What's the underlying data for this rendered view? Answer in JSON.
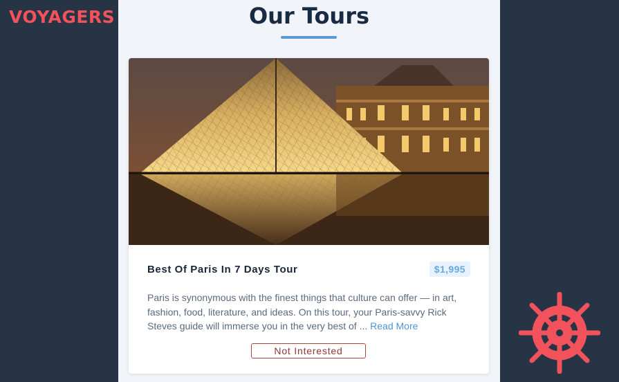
{
  "brand": {
    "name": "VOYAGERS",
    "color": "#f2525c"
  },
  "page": {
    "title": "Our Tours"
  },
  "tour": {
    "name": "Best Of Paris In 7 Days Tour",
    "price": "$1,995",
    "description": "Paris is synonymous with the finest things that culture can offer — in art, fashion, food, literature, and ideas. On this tour, your Paris-savvy Rick Steves guide will immerse you in the very best of ...",
    "read_more": "Read More",
    "image_icon": "louvre-pyramid-photo"
  },
  "actions": {
    "not_interested": "Not Interested"
  },
  "icons": {
    "helm": "ship-wheel-icon"
  },
  "colors": {
    "accent": "#5a97d3",
    "brand": "#f2525c",
    "background": "#263445"
  }
}
